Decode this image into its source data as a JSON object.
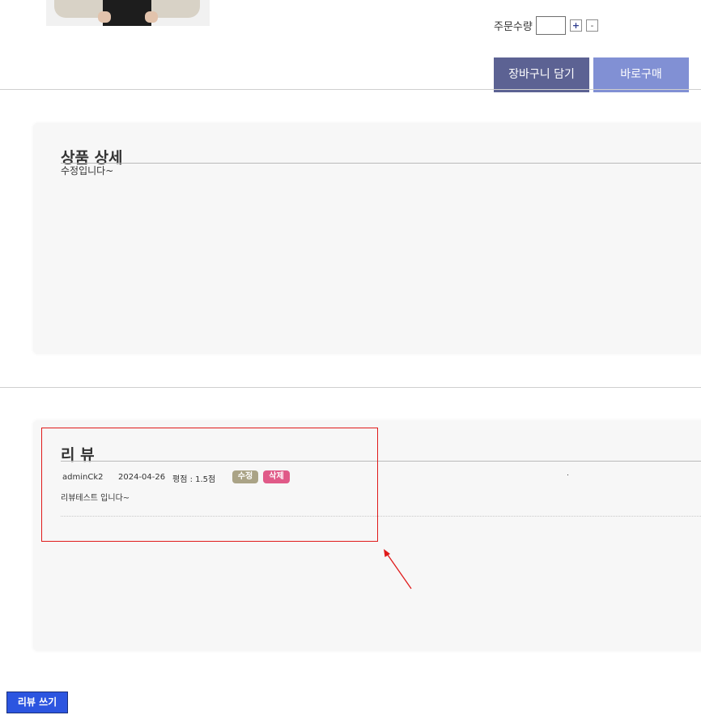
{
  "product": {
    "image_icon": "product-photo"
  },
  "order": {
    "quantity_label": "주문수량",
    "quantity_value": "",
    "plus_label": "+",
    "minus_label": "-",
    "cart_button": "장바구니 담기",
    "buy_button": "바로구매"
  },
  "detail": {
    "title": "상품 상세",
    "text": "수정입니다~"
  },
  "review": {
    "title": "리 뷰",
    "items": [
      {
        "author": "adminCk2",
        "date": "2024-04-26",
        "rating": "평점 : 1.5점",
        "edit_label": "수정",
        "delete_label": "삭제",
        "content": "리뷰테스트 입니다~"
      }
    ],
    "write_button": "리뷰 쓰기"
  },
  "annotation": {
    "color": "#e01b1b"
  },
  "colors": {
    "cart": "#5c6293",
    "buy": "#8190d4",
    "edit_badge": "#aaa386",
    "delete_badge": "#e05a88",
    "write_button": "#2c55e0"
  }
}
